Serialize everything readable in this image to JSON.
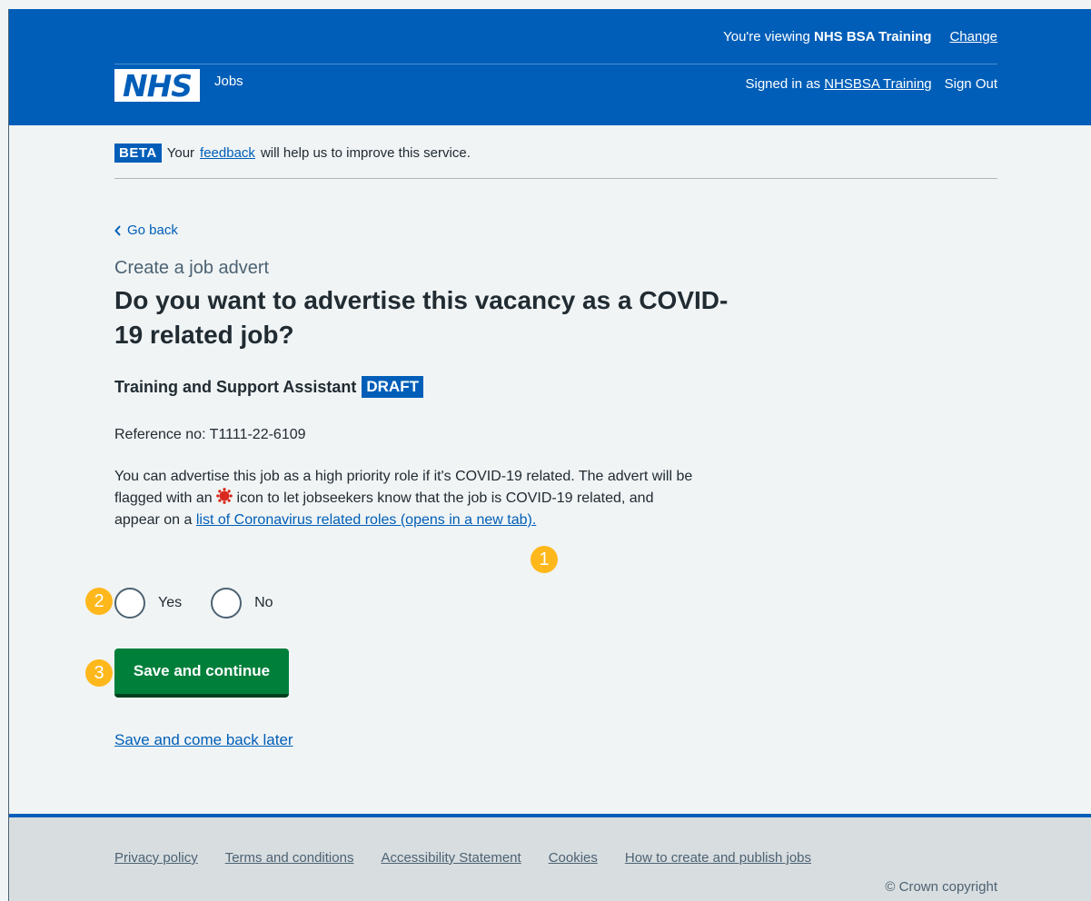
{
  "header": {
    "viewing_prefix": "You're viewing",
    "org_name": "NHS BSA Training",
    "change_label": "Change",
    "logo_text": "NHS",
    "service_name": "Jobs",
    "signed_in_prefix": "Signed in as",
    "user_name": "NHSBSA Training",
    "sign_out_label": "Sign Out"
  },
  "beta": {
    "tag": "BETA",
    "text_before": "Your",
    "link": "feedback",
    "text_after": "will help us to improve this service."
  },
  "back_link": "Go back",
  "caption": "Create a job advert",
  "heading": "Do you want to advertise this vacancy as a COVID-19 related job?",
  "job": {
    "title": "Training and Support Assistant",
    "status": "DRAFT",
    "reference": "Reference no: T1111-22-6109"
  },
  "description": {
    "part1": "You can advertise this job as a high priority role if it's COVID-19 related. The advert will be flagged with an",
    "part2": "icon to let jobseekers know that the job is COVID-19 related, and appear on a",
    "link": "list of Coronavirus related roles (opens in a new tab)."
  },
  "options": [
    {
      "label": "Yes",
      "selected": false
    },
    {
      "label": "No",
      "selected": false
    }
  ],
  "save_continue_label": "Save and continue",
  "save_later_label": "Save and come back later",
  "badges": [
    "1",
    "2",
    "3"
  ],
  "footer": {
    "links": [
      "Privacy policy",
      "Terms and conditions",
      "Accessibility Statement",
      "Cookies",
      "How to create and publish jobs"
    ],
    "copyright": "© Crown copyright"
  },
  "colors": {
    "nhs_blue": "#005eb8",
    "button_green": "#007f3b",
    "badge_yellow": "#ffb81c",
    "virus_red": "#da291c"
  }
}
